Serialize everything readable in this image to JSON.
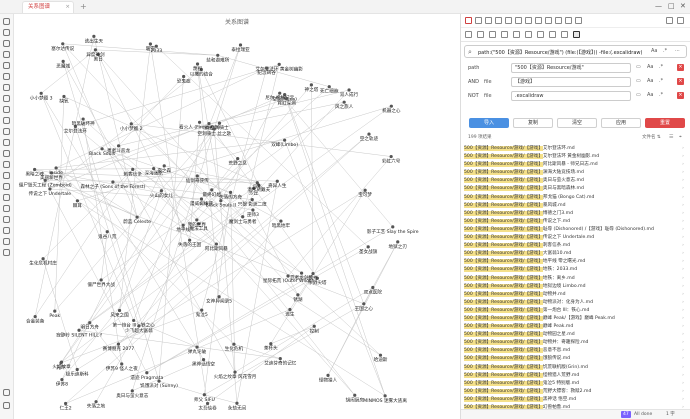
{
  "window": {
    "tab_label": "关系图谱",
    "tab_close": "×",
    "new_tab": "+",
    "controls": [
      "—",
      "□",
      "✕"
    ]
  },
  "canvas": {
    "title": "关系图谱"
  },
  "graph": {
    "nodes": [
      {
        "label": "阿比斯风暴"
      },
      {
        "label": "艾尔登法环"
      },
      {
        "label": "魔法工具"
      },
      {
        "label": "火焰纹章"
      },
      {
        "label": "沙丘"
      },
      {
        "label": "少飞超大富翁"
      },
      {
        "label": "艾尔登法环 黄金树幽影"
      },
      {
        "label": "空洞骑士"
      },
      {
        "label": "空洞(Neva)"
      },
      {
        "label": "魔剑士与勇者"
      },
      {
        "label": "奥日"
      },
      {
        "label": "MINMOS 迷雾大逃离"
      },
      {
        "label": "棘耳"
      },
      {
        "label": "机器之心"
      },
      {
        "label": "失落的王国"
      },
      {
        "label": "双峰(Limbo)"
      },
      {
        "label": "失落之地"
      },
      {
        "label": "看火人 (Firewatch)"
      },
      {
        "label": "荒野之息"
      },
      {
        "label": "明日方舟"
      },
      {
        "label": "夜之森"
      },
      {
        "label": "伊苏8"
      },
      {
        "label": "伊苏9 怪人之夜"
      },
      {
        "label": "瞬光"
      },
      {
        "label": "潜水员戴夫"
      },
      {
        "label": "杀戮尖塔"
      },
      {
        "label": "暗黑破坏神"
      },
      {
        "label": "以撒的结合"
      },
      {
        "label": "传说之下 Undertale"
      },
      {
        "label": "星际拓荒 (Outer Wilds)"
      },
      {
        "label": "彩虹六号"
      },
      {
        "label": "我的世界"
      },
      {
        "label": "弹丸论破"
      },
      {
        "label": "漫威蜘蛛侠"
      },
      {
        "label": "小小梦魇 2"
      },
      {
        "label": "神之塔"
      },
      {
        "label": "第一炮台 III：铁之心"
      },
      {
        "label": "胡闹厨房"
      },
      {
        "label": "哈迪斯"
      },
      {
        "label": "饥荒"
      },
      {
        "label": "泰拉瑞亚"
      },
      {
        "label": "深海迷航"
      },
      {
        "label": "森林之子 (Sons of the Forest)"
      },
      {
        "label": "逃生"
      },
      {
        "label": "奥日与萤火意志"
      },
      {
        "label": "黑暗之魂"
      },
      {
        "label": "只狼 影逝二度"
      },
      {
        "label": "仁王2"
      },
      {
        "label": "黑神话悟空"
      },
      {
        "label": "巫师3"
      },
      {
        "label": "寂静岭 SILENT HILL f"
      },
      {
        "label": "空之轨迹"
      },
      {
        "label": "小小梦魇 3"
      },
      {
        "label": "锈湖"
      },
      {
        "label": "艾迪芬奇的记忆"
      },
      {
        "label": "赛博朋克 2077"
      },
      {
        "label": "异度神剑"
      },
      {
        "label": "塞尔达传说"
      },
      {
        "label": "生化危机"
      },
      {
        "label": "双人成行"
      },
      {
        "label": "盐和避难所"
      },
      {
        "label": "蔚蓝 Celeste"
      },
      {
        "label": "Inside"
      },
      {
        "label": "勇者斗恶龙"
      },
      {
        "label": "死亡细胞"
      },
      {
        "label": "逃出生天"
      },
      {
        "label": "纪念碑谷"
      },
      {
        "label": "恐鬼症"
      },
      {
        "label": "最终幻想"
      },
      {
        "label": "合金装备"
      },
      {
        "label": "鬼泣5"
      },
      {
        "label": "饥饿派对 (Sunny)"
      },
      {
        "label": "忍者龙剑传"
      },
      {
        "label": "刺客信条"
      },
      {
        "label": "光环"
      },
      {
        "label": "恶魔城"
      },
      {
        "label": "Black Souls"
      },
      {
        "label": "生化危机村庄"
      },
      {
        "label": "仙剑奇侠传"
      },
      {
        "label": "火焰之纹章 风花雪月"
      },
      {
        "label": "失落的方舟"
      },
      {
        "label": "极乐迪斯科"
      },
      {
        "label": "暗黑地牢"
      },
      {
        "label": "双点医院"
      },
      {
        "label": "师父 SIFU"
      },
      {
        "label": "宝可梦"
      },
      {
        "label": "女神异闻录5"
      },
      {
        "label": "怪物猎人"
      },
      {
        "label": "永劫无间"
      },
      {
        "label": "茶杯头"
      },
      {
        "label": "蔑视"
      },
      {
        "label": "地狱之刃"
      },
      {
        "label": "奇异人生"
      },
      {
        "label": "控制"
      },
      {
        "label": "Black Souls II"
      },
      {
        "label": "王国之心"
      },
      {
        "label": "美丽新世界"
      },
      {
        "label": "太吾绘卷"
      },
      {
        "label": "尼尔 机械纪元"
      },
      {
        "label": "霓虹深渊"
      },
      {
        "label": "鬼谷八荒"
      },
      {
        "label": "暖雪"
      },
      {
        "label": "影子工艺 Slay the Spire"
      },
      {
        "label": "僵尸毁灭工程 (Zomboid)"
      },
      {
        "label": "僵尸世界大战"
      },
      {
        "label": "风来之国"
      },
      {
        "label": "遗迹 Pragmata"
      },
      {
        "label": "异形"
      },
      {
        "label": "风之旅人"
      },
      {
        "label": "火山的女儿"
      },
      {
        "label": "圣女战旗"
      },
      {
        "label": "缺氧"
      },
      {
        "label": "空洞骑士 丝之歌"
      },
      {
        "label": "地平线"
      },
      {
        "label": "2033"
      },
      {
        "label": "Peak"
      }
    ],
    "edges": [
      [
        0,
        1
      ],
      [
        0,
        2
      ],
      [
        0,
        3
      ],
      [
        1,
        5
      ],
      [
        1,
        6
      ],
      [
        2,
        4
      ],
      [
        3,
        7
      ],
      [
        6,
        9
      ],
      [
        7,
        8
      ],
      [
        8,
        11
      ],
      [
        9,
        10
      ],
      [
        10,
        14
      ],
      [
        11,
        15
      ],
      [
        11,
        12
      ],
      [
        12,
        13
      ],
      [
        13,
        19
      ],
      [
        14,
        17
      ],
      [
        17,
        18
      ],
      [
        18,
        21
      ],
      [
        16,
        14
      ],
      [
        19,
        22
      ],
      [
        20,
        21
      ],
      [
        22,
        26
      ],
      [
        23,
        25
      ],
      [
        24,
        27
      ],
      [
        25,
        29
      ],
      [
        26,
        31
      ],
      [
        27,
        28
      ],
      [
        28,
        33
      ],
      [
        29,
        30
      ],
      [
        30,
        34
      ],
      [
        31,
        35
      ],
      [
        32,
        36
      ],
      [
        33,
        37
      ],
      [
        34,
        38
      ],
      [
        35,
        39
      ],
      [
        36,
        40
      ],
      [
        37,
        41
      ],
      [
        38,
        42
      ],
      [
        39,
        43
      ],
      [
        40,
        44
      ],
      [
        41,
        45
      ],
      [
        42,
        46
      ],
      [
        43,
        47
      ],
      [
        44,
        48
      ],
      [
        45,
        49
      ],
      [
        46,
        50
      ],
      [
        47,
        51
      ],
      [
        48,
        52
      ],
      [
        49,
        53
      ],
      [
        50,
        54
      ],
      [
        51,
        55
      ],
      [
        52,
        56
      ],
      [
        53,
        57
      ],
      [
        54,
        58
      ],
      [
        55,
        59
      ],
      [
        56,
        60
      ],
      [
        57,
        61
      ],
      [
        58,
        62
      ],
      [
        59,
        63
      ],
      [
        60,
        64
      ],
      [
        61,
        65
      ],
      [
        62,
        66
      ],
      [
        63,
        67
      ],
      [
        64,
        68
      ],
      [
        65,
        69
      ],
      [
        66,
        70
      ],
      [
        67,
        71
      ],
      [
        68,
        72
      ],
      [
        69,
        73
      ],
      [
        70,
        74
      ],
      [
        71,
        75
      ],
      [
        72,
        76
      ],
      [
        73,
        77
      ],
      [
        74,
        78
      ],
      [
        75,
        79
      ],
      [
        76,
        80
      ],
      [
        77,
        81
      ],
      [
        78,
        82
      ],
      [
        79,
        83
      ],
      [
        80,
        84
      ],
      [
        81,
        85
      ],
      [
        82,
        86
      ],
      [
        83,
        87
      ],
      [
        84,
        88
      ],
      [
        85,
        89
      ],
      [
        86,
        90
      ],
      [
        87,
        91
      ],
      [
        88,
        92
      ],
      [
        89,
        93
      ],
      [
        90,
        94
      ],
      [
        91,
        95
      ],
      [
        92,
        96
      ],
      [
        93,
        97
      ],
      [
        94,
        98
      ],
      [
        95,
        99
      ],
      [
        96,
        100
      ],
      [
        97,
        101
      ],
      [
        98,
        102
      ],
      [
        99,
        103
      ],
      [
        100,
        104
      ],
      [
        101,
        105
      ],
      [
        102,
        106
      ],
      [
        103,
        107
      ],
      [
        104,
        108
      ],
      [
        105,
        109
      ],
      [
        106,
        110
      ],
      [
        107,
        111
      ],
      [
        108,
        112
      ],
      [
        109,
        113
      ],
      [
        110,
        114
      ],
      [
        111,
        115
      ],
      [
        15,
        62
      ],
      [
        62,
        61
      ],
      [
        61,
        45
      ],
      [
        20,
        24
      ],
      [
        23,
        28
      ],
      [
        36,
        52
      ],
      [
        57,
        60
      ],
      [
        71,
        84
      ],
      [
        84,
        95
      ],
      [
        95,
        103
      ],
      [
        103,
        106
      ],
      [
        115,
        112
      ],
      [
        112,
        88
      ],
      [
        79,
        80
      ]
    ]
  },
  "search": {
    "query": "path:(\"500【资源】Resource/游戏\") (file:(【游戏】)) -file:(.excalidraw)",
    "options": [
      "Aa",
      ".*",
      "⋯"
    ]
  },
  "filters": [
    {
      "op": "path",
      "field": "",
      "value": "\"500【资源】Resource/游戏\""
    },
    {
      "op": "AND",
      "field": "file",
      "value": "【游戏】"
    },
    {
      "op": "NOT",
      "field": "file",
      "value": ".excalidraw"
    }
  ],
  "actions": {
    "import": "导入",
    "copy": "复制",
    "clear": "清空",
    "apply": "应用",
    "reset": "重置"
  },
  "results_bar": {
    "count": "199 项结果",
    "sort": "文件名 ⇅"
  },
  "results": [
    {
      "path": "500【资源】Resource/游戏/【游戏】",
      "name": "艾尔登法环.md"
    },
    {
      "path": "500【资源】Resource/游戏/【游戏】",
      "name": "艾尔登法环 黄金树幽影.md"
    },
    {
      "path": "500【资源】Resource/游戏/【游戏】",
      "name": "阿比斯风暴 - 师兄日志.md"
    },
    {
      "path": "500【资源】Resource/游戏/【游戏】",
      "name": "渊海大陆竞技场.md"
    },
    {
      "path": "500【资源】Resource/游戏/【游戏】",
      "name": "奥日与萤火意志.md"
    },
    {
      "path": "500【资源】Resource/游戏/【游戏】",
      "name": "奥日与黑暗森林.md"
    },
    {
      "path": "500【资源】Resource/游戏/【游戏】",
      "name": "邦戈猫 (Bongo Cat).md"
    },
    {
      "path": "500【资源】Resource/游戏/【游戏】",
      "name": "暴风城.md"
    },
    {
      "path": "500【资源】Resource/游戏/【游戏】",
      "name": "博德之门3.md"
    },
    {
      "path": "500【资源】Resource/游戏/【游戏】",
      "name": "传说之下.md"
    },
    {
      "path": "500【资源】Resource/游戏/【游戏】",
      "name": "耻辱 (Dishonored) /【游戏】耻辱 (Dishonored).md"
    },
    {
      "path": "500【资源】Resource/游戏/【游戏】",
      "name": "传说之下 Undertale.md"
    },
    {
      "path": "500【资源】Resource/游戏/【游戏】",
      "name": "刺客信条.md"
    },
    {
      "path": "500【资源】Resource/游戏/【游戏】",
      "name": "大富翁10.md"
    },
    {
      "path": "500【资源】Resource/游戏/【游戏】",
      "name": "地平线 零之曙光.md"
    },
    {
      "path": "500【资源】Resource/游戏/【游戏】",
      "name": "地铁：2033.md"
    },
    {
      "path": "500【资源】Resource/游戏/【游戏】",
      "name": "地铁：离乡.md"
    },
    {
      "path": "500【资源】Resource/游戏/【游戏】",
      "name": "地狱边境 Limbo.md"
    },
    {
      "path": "500【资源】Resource/游戏/【游戏】",
      "name": "动物井.md"
    },
    {
      "path": "500【资源】Resource/游戏/【游戏】",
      "name": "动物派对：化身为人.md"
    },
    {
      "path": "500【资源】Resource/游戏/【游戏】",
      "name": "第一炮台 III：铁心.md"
    },
    {
      "path": "500【资源】Resource/游戏/【游戏】",
      "name": "巅峰 Peak/【游戏】巅峰 Peak.md"
    },
    {
      "path": "500【资源】Resource/游戏/【游戏】",
      "name": "巅峰 Peak.md"
    },
    {
      "path": "500【资源】Resource/游戏/【游戏】",
      "name": "动物园之星.md"
    },
    {
      "path": "500【资源】Resource/游戏/【游戏】",
      "name": "动物井：奇趣探险.md"
    },
    {
      "path": "500【资源】Resource/游戏/【游戏】",
      "name": "恶意不息.md"
    },
    {
      "path": "500【资源】Resource/游戏/【游戏】",
      "name": "饿狼传说.md"
    },
    {
      "path": "500【资源】Resource/游戏/【游戏】",
      "name": "饥荒联机版(Grin).md"
    },
    {
      "path": "500【资源】Resource/游戏/【游戏】",
      "name": "怪物猎人荒野.md"
    },
    {
      "path": "500【资源】Resource/游戏/【游戏】",
      "name": "鬼泣5 特别版.md"
    },
    {
      "path": "500【资源】Resource/游戏/【游戏】",
      "name": "荒野大镖客：救赎2.md"
    },
    {
      "path": "500【资源】Resource/游戏/【游戏】",
      "name": "黑神话 悟空.md"
    },
    {
      "path": "500【资源】Resource/游戏/【游戏】",
      "name": "幻兽帕鲁.md"
    },
    {
      "path": "500【资源】Resource/游戏/【游戏】",
      "name": "饥荒联机版.md"
    },
    {
      "path": "500【资源】Resource/游戏/【游戏】",
      "name": "寂静岭 SILENT HILL f.md"
    },
    {
      "path": "500【资源】Resource/游戏/【游戏】",
      "name": "孤岛惊魂.md"
    }
  ],
  "status": {
    "badge": "47",
    "text": "All done",
    "extra": "1 字"
  }
}
